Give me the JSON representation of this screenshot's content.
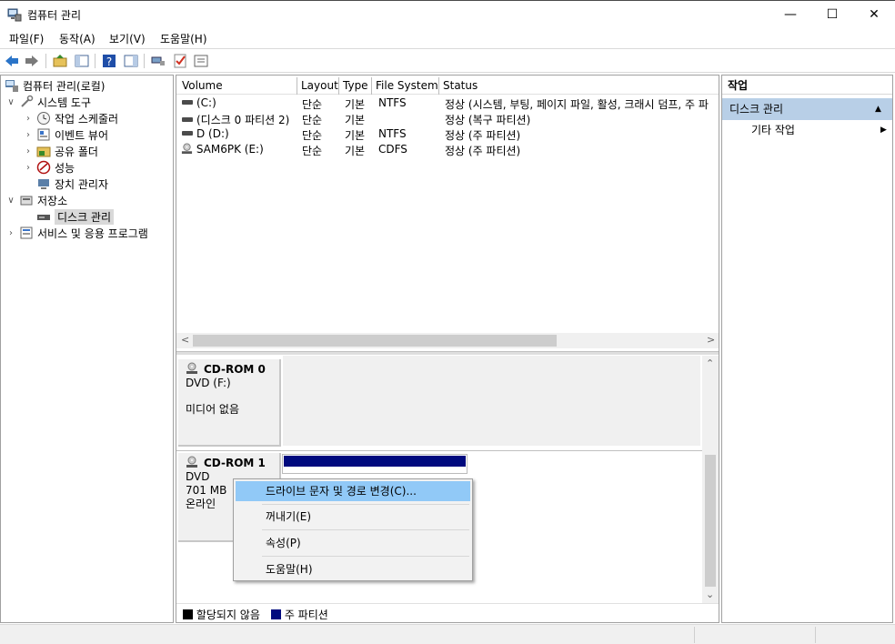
{
  "window": {
    "title": "컴퓨터 관리",
    "icon": "computer-management-icon",
    "controls": {
      "minimize": "—",
      "maximize": "☐",
      "close": "✕"
    }
  },
  "menu": [
    "파일(F)",
    "동작(A)",
    "보기(V)",
    "도움말(H)"
  ],
  "toolbar_icons": [
    "back-arrow-icon",
    "forward-arrow-icon",
    "up-folder-icon",
    "show-hide-tree-icon",
    "help-icon",
    "show-hide-action-icon",
    "connect-icon",
    "check-icon",
    "properties-icon"
  ],
  "tree": {
    "root": "컴퓨터 관리(로컬)",
    "system_tools": "시스템 도구",
    "task_scheduler": "작업 스케줄러",
    "event_viewer": "이벤트 뷰어",
    "shared_folders": "공유 폴더",
    "performance": "성능",
    "device_manager": "장치 관리자",
    "storage": "저장소",
    "disk_management": "디스크 관리",
    "services_apps": "서비스 및 응용 프로그램"
  },
  "volume_table": {
    "columns": [
      "Volume",
      "Layout",
      "Type",
      "File System",
      "Status"
    ],
    "rows": [
      [
        "(C:)",
        "단순",
        "기본",
        "NTFS",
        "정상 (시스템, 부팅, 페이지 파일, 활성, 크래시 덤프, 주 파"
      ],
      [
        "(디스크 0 파티션 2)",
        "단순",
        "기본",
        "",
        "정상 (복구 파티션)"
      ],
      [
        "D (D:)",
        "단순",
        "기본",
        "NTFS",
        "정상 (주 파티션)"
      ],
      [
        "SAM6PK (E:)",
        "단순",
        "기본",
        "CDFS",
        "정상 (주 파티션)"
      ]
    ]
  },
  "disks": {
    "cdrom0": {
      "name": "CD-ROM 0",
      "type": "DVD (F:)",
      "status": "미디어 없음"
    },
    "cdrom1": {
      "name": "CD-ROM 1",
      "type": "DVD",
      "size": "701 MB",
      "status": "온라인"
    }
  },
  "legend": {
    "unallocated": "할당되지 않음",
    "primary": "주 파티션",
    "unallocated_color": "#000000",
    "primary_color": "#000a7e"
  },
  "context_menu": [
    "드라이브 문자 및 경로 변경(C)...",
    "꺼내기(E)",
    "속성(P)",
    "도움말(H)"
  ],
  "actions": {
    "header": "작업",
    "section": "디스크 관리",
    "more": "기타 작업"
  },
  "colors": {
    "accent_selection": "#91c9f7",
    "actions_section": "#b8cfe7"
  }
}
